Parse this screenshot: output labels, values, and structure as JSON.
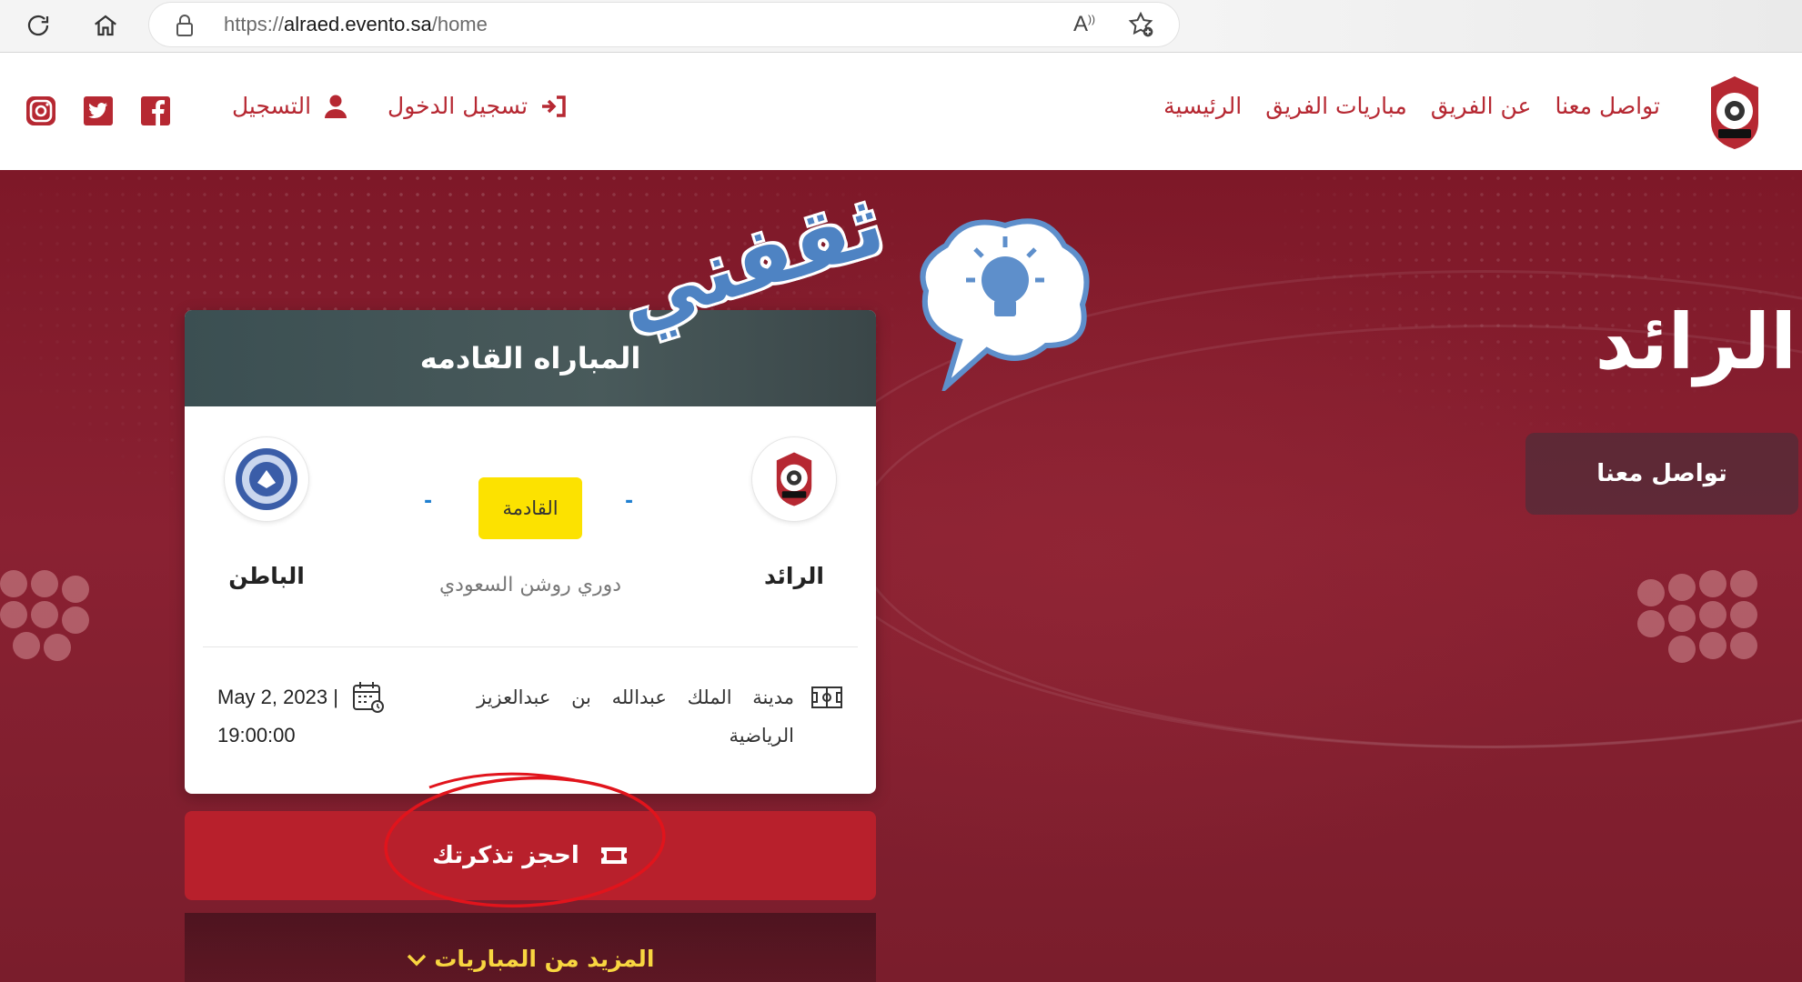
{
  "browser": {
    "url_scheme": "https://",
    "url_host": "alraed.evento.sa",
    "url_path": "/home",
    "read_aloud_label": "A"
  },
  "header": {
    "nav": [
      {
        "label": "الرئيسية"
      },
      {
        "label": "مباريات الفريق"
      },
      {
        "label": "عن الفريق"
      },
      {
        "label": "تواصل معنا"
      }
    ],
    "login_label": "تسجيل الدخول",
    "register_label": "التسجيل",
    "social": [
      "facebook-icon",
      "twitter-icon",
      "instagram-icon"
    ],
    "brand_color": "#b62832"
  },
  "hero": {
    "title": "الرائد",
    "contact_button": "تواصل معنا"
  },
  "match_card": {
    "heading": "المباراه القادمه",
    "home_team": "الرائد",
    "away_team": "الباطن",
    "home_score": "-",
    "away_score": "-",
    "status": "القادمة",
    "competition": "دوري روشن السعودي",
    "venue": "مدينة الملك عبدالله بن عبدالعزيز الرياضية",
    "date": "May 2, 2023 |",
    "time": "19:00:00",
    "status_color": "#fce200"
  },
  "book_ticket": {
    "label": "احجز تذكرتك",
    "color": "#b8202c"
  },
  "more_matches": {
    "label": "المزيد من المباريات"
  },
  "watermark": {
    "text": "ثقفني"
  }
}
